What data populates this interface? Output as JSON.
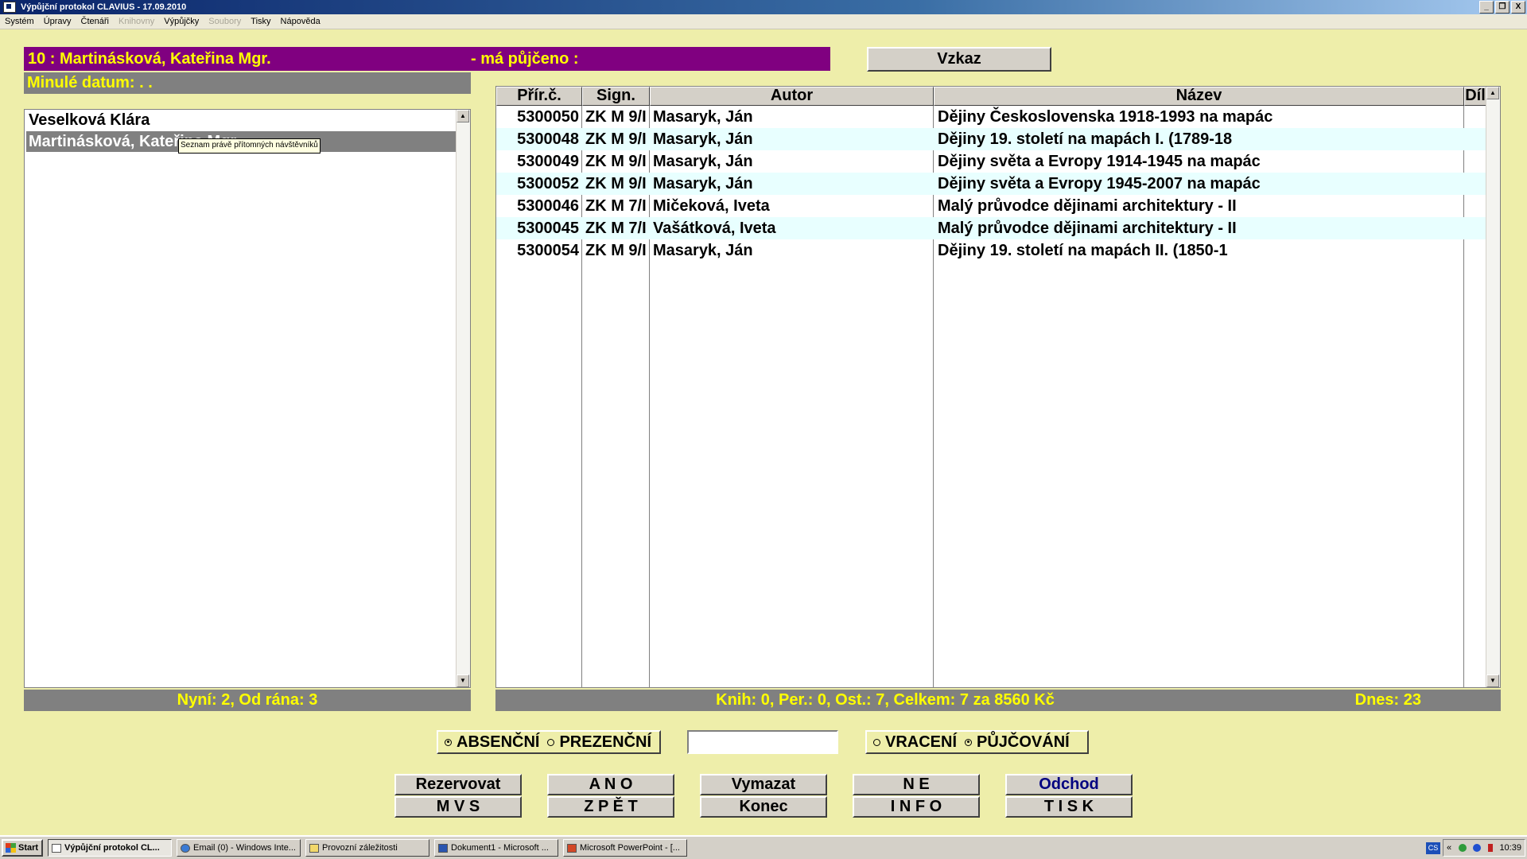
{
  "window": {
    "title": "Výpůjční protokol CLAVIUS - 17.09.2010",
    "minimize": "_",
    "restore": "❐",
    "close": "X"
  },
  "menu": [
    {
      "label": "Systém",
      "enabled": true
    },
    {
      "label": "Úpravy",
      "enabled": true
    },
    {
      "label": "Čtenáři",
      "enabled": true
    },
    {
      "label": "Knihovny",
      "enabled": false
    },
    {
      "label": "Výpůjčky",
      "enabled": true
    },
    {
      "label": "Soubory",
      "enabled": false
    },
    {
      "label": "Tisky",
      "enabled": true
    },
    {
      "label": "Nápověda",
      "enabled": true
    }
  ],
  "patron": {
    "name": "10 : Martinásková, Kateřina Mgr.",
    "borrowed_label": "- má půjčeno :",
    "past_date": "Minulé datum:   .  ."
  },
  "vzkaz_label": "Vzkaz",
  "visitors": {
    "items": [
      {
        "name": "Veselková Klára",
        "selected": false
      },
      {
        "name": "Martinásková, Kateřina Mgr.",
        "selected": true
      }
    ],
    "tooltip": "Seznam právě přítomných návštěvníků",
    "status": "Nyní: 2, Od rána: 3"
  },
  "loans": {
    "headers": [
      "Přír.č.",
      "Sign.",
      "Autor",
      "Název",
      "Díl"
    ],
    "rows": [
      {
        "acc": "5300050",
        "sign": "ZK M 9/I",
        "author": "Masaryk, Ján",
        "title": "Dějiny Československa 1918-1993 na mapác",
        "part": ""
      },
      {
        "acc": "5300048",
        "sign": "ZK M 9/I",
        "author": "Masaryk, Ján",
        "title": "Dějiny 19. století na mapách I. (1789-18",
        "part": ""
      },
      {
        "acc": "5300049",
        "sign": "ZK M 9/I",
        "author": "Masaryk, Ján",
        "title": "Dějiny světa a Evropy 1914-1945 na mapác",
        "part": ""
      },
      {
        "acc": "5300052",
        "sign": "ZK M 9/I",
        "author": "Masaryk, Ján",
        "title": "Dějiny světa a Evropy 1945-2007 na mapác",
        "part": ""
      },
      {
        "acc": "5300046",
        "sign": "ZK M 7/I",
        "author": "Mičeková, Iveta",
        "title": "Malý průvodce dějinami architektury - II",
        "part": ""
      },
      {
        "acc": "5300045",
        "sign": "ZK M 7/I",
        "author": "Vašátková, Iveta",
        "title": "Malý průvodce dějinami architektury - II",
        "part": ""
      },
      {
        "acc": "5300054",
        "sign": "ZK M 9/I",
        "author": "Masaryk, Ján",
        "title": "Dějiny 19. století na mapách II. (1850-1",
        "part": ""
      }
    ],
    "totals": "Knih: 0, Per.: 0, Ost.: 7, Celkem: 7 za 8560 Kč",
    "today": "Dnes: 23"
  },
  "loan_type": {
    "options": [
      {
        "label": "ABSENČNÍ",
        "selected": true
      },
      {
        "label": "PREZENČNÍ",
        "selected": false
      }
    ]
  },
  "barcode": {
    "value": "",
    "placeholder": ""
  },
  "mode": {
    "options": [
      {
        "label": "VRACENÍ",
        "selected": false
      },
      {
        "label": "PŮJČOVÁNÍ",
        "selected": true
      }
    ]
  },
  "buttons": {
    "rezervovat": "Rezervovat",
    "ano": "A N O",
    "vymazat": "Vymazat",
    "ne": "N E",
    "odchod": "Odchod",
    "mvs": "M V S",
    "zpet": "Z P Ě T",
    "konec": "Konec",
    "info": "I N F O",
    "tisk": "T I S K"
  },
  "taskbar": {
    "start": "Start",
    "tasks": [
      {
        "label": "Výpůjční protokol CL...",
        "active": true
      },
      {
        "label": "Email (0) - Windows Inte...",
        "active": false
      },
      {
        "label": "Provozní záležitosti",
        "active": false
      },
      {
        "label": "Dokument1 - Microsoft ...",
        "active": false
      },
      {
        "label": "Microsoft PowerPoint - [...",
        "active": false
      }
    ],
    "lang": "CS",
    "tray_arrow": "«",
    "clock": "10:39"
  },
  "colors": {
    "client_bg": "#eeeeaa",
    "header_purple": "#800080",
    "status_yellow": "#ffff00",
    "alt_row": "#e8ffff"
  }
}
